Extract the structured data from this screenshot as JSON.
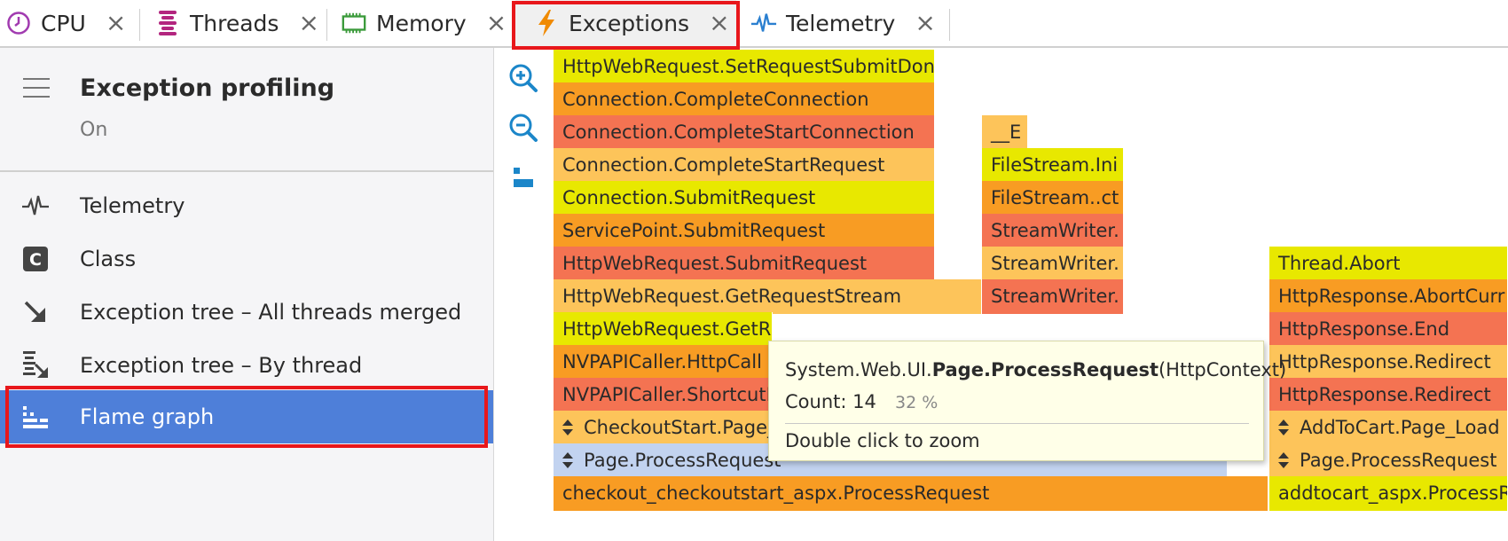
{
  "tabs": [
    {
      "label": "CPU",
      "icon": "clock-icon",
      "color": "#a13bb0"
    },
    {
      "label": "Threads",
      "icon": "threads-icon",
      "color": "#b3267f"
    },
    {
      "label": "Memory",
      "icon": "memory-chip-icon",
      "color": "#3a9a3a"
    },
    {
      "label": "Exceptions",
      "icon": "lightning-icon",
      "color": "#f08a00"
    },
    {
      "label": "Telemetry",
      "icon": "pulse-icon",
      "color": "#2a7fd0"
    }
  ],
  "sidebar": {
    "title": "Exception profiling",
    "status": "On",
    "items": [
      {
        "label": "Telemetry",
        "icon": "pulse-icon"
      },
      {
        "label": "Class",
        "icon": "class-icon"
      },
      {
        "label": "Exception tree – All threads merged",
        "icon": "arrow-down-right-icon"
      },
      {
        "label": "Exception tree – By thread",
        "icon": "thread-tree-icon"
      },
      {
        "label": "Flame graph",
        "icon": "flame-graph-icon"
      }
    ]
  },
  "tools": [
    {
      "name": "zoom-in-icon"
    },
    {
      "name": "zoom-out-icon"
    },
    {
      "name": "reset-zoom-icon"
    }
  ],
  "colors": {
    "yellow": "#e8e800",
    "orange": "#f89c23",
    "red": "#f47352",
    "lightorange": "#fdc45a",
    "selected": "#c2d3f0"
  },
  "flame": [
    {
      "label": "HttpWebRequest.SetRequestSubmitDon",
      "color": "yellow"
    },
    {
      "label": "Connection.CompleteConnection",
      "color": "orange"
    },
    {
      "label": "Connection.CompleteStartConnection",
      "color": "red"
    },
    {
      "label": "Connection.CompleteStartRequest",
      "color": "lightorange"
    },
    {
      "label": "Connection.SubmitRequest",
      "color": "yellow"
    },
    {
      "label": "ServicePoint.SubmitRequest",
      "color": "orange"
    },
    {
      "label": "HttpWebRequest.SubmitRequest",
      "color": "red"
    },
    {
      "label": "HttpWebRequest.GetRequestStream",
      "color": "lightorange"
    },
    {
      "label": "HttpWebRequest.GetR",
      "color": "yellow"
    },
    {
      "label": "NVPAPICaller.HttpCall",
      "color": "orange"
    },
    {
      "label": "NVPAPICaller.ShortcutE",
      "color": "red"
    },
    {
      "label": "CheckoutStart.Page_Load",
      "color": "lightorange",
      "expand": true
    },
    {
      "label": "Page.ProcessRequest",
      "color": "selected",
      "expand": true
    },
    {
      "label": "checkout_checkoutstart_aspx.ProcessRequest",
      "color": "orange"
    },
    {
      "label": "__E",
      "color": "lightorange"
    },
    {
      "label": "FileStream.Ini",
      "color": "yellow"
    },
    {
      "label": "FileStream..ct",
      "color": "orange"
    },
    {
      "label": "StreamWriter.",
      "color": "red"
    },
    {
      "label": "StreamWriter.",
      "color": "lightorange"
    },
    {
      "label": "StreamWriter.",
      "color": "red"
    },
    {
      "label": "Thread.Abort",
      "color": "yellow"
    },
    {
      "label": "HttpResponse.AbortCurr",
      "color": "orange"
    },
    {
      "label": "HttpResponse.End",
      "color": "red"
    },
    {
      "label": "HttpResponse.Redirect",
      "color": "lightorange"
    },
    {
      "label": "HttpResponse.Redirect",
      "color": "red"
    },
    {
      "label": "AddToCart.Page_Load",
      "color": "lightorange",
      "expand": true
    },
    {
      "label": "Page.ProcessRequest",
      "color": "lightorange",
      "expand": true
    },
    {
      "label": "addtocart_aspx.ProcessR",
      "color": "yellow"
    }
  ],
  "tooltip": {
    "sig_prefix": "System.Web.UI.",
    "sig_bold": "Page.ProcessRequest",
    "sig_suffix": "(HttpContext)",
    "count": "Count: 14",
    "percent": "32 %",
    "hint": "Double click to zoom"
  }
}
